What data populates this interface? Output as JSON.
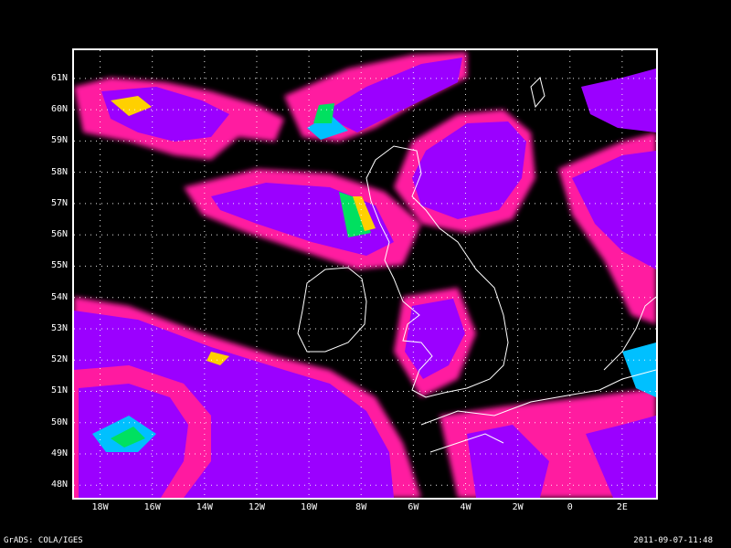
{
  "map": {
    "lat_labels": [
      "61N",
      "60N",
      "59N",
      "58N",
      "57N",
      "56N",
      "55N",
      "54N",
      "53N",
      "52N",
      "51N",
      "50N",
      "49N",
      "48N"
    ],
    "lon_labels": [
      "18W",
      "16W",
      "14W",
      "12W",
      "10W",
      "8W",
      "6W",
      "4W",
      "2W",
      "0",
      "2E"
    ],
    "lat_range": [
      47.6,
      61.9
    ],
    "lon_range": [
      -19.0,
      3.3
    ],
    "grid": "dotted",
    "coastline_color": "#ffffff",
    "field_palette": [
      "#9b00ff",
      "#6a00ff",
      "#2040ff",
      "#00c0ff",
      "#00e060",
      "#ffd000",
      "#ff8000",
      "#ff0080",
      "#ff1aa0"
    ]
  },
  "footer": {
    "left": "GrADS: COLA/IGES",
    "right": "2011-09-07-11:48"
  }
}
